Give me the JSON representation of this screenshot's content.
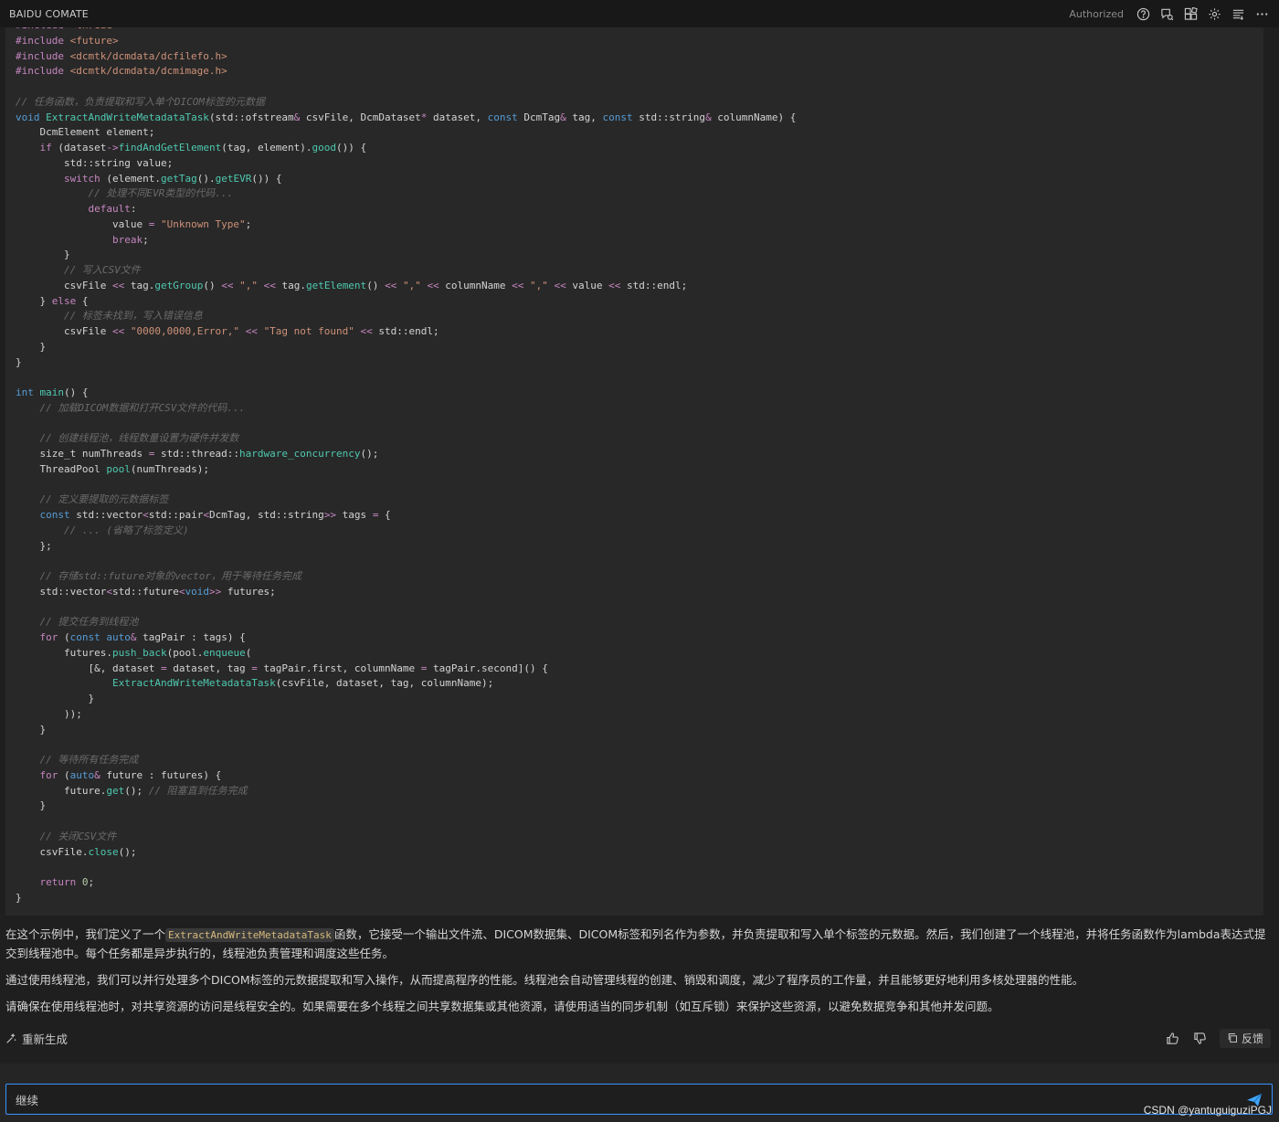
{
  "app": {
    "title": "BAIDU COMATE",
    "status": "Authorized"
  },
  "toolbar_icons": [
    "help-icon",
    "chat-history-icon",
    "plugins-icon",
    "settings-icon",
    "menu-list-icon",
    "more-icon"
  ],
  "code_lines": [
    [
      [
        "pp",
        "#include"
      ],
      [
        "op",
        " "
      ],
      [
        "inc",
        "<thread>"
      ]
    ],
    [
      [
        "pp",
        "#include"
      ],
      [
        "op",
        " "
      ],
      [
        "inc",
        "<future>"
      ]
    ],
    [
      [
        "pp",
        "#include"
      ],
      [
        "op",
        " "
      ],
      [
        "inc",
        "<dcmtk/dcmdata/dcfilefo.h>"
      ]
    ],
    [
      [
        "pp",
        "#include"
      ],
      [
        "op",
        " "
      ],
      [
        "inc",
        "<dcmtk/dcmdata/dcmimage.h>"
      ]
    ],
    [],
    [
      [
        "cm",
        "// 任务函数，负责提取和写入单个DICOM标签的元数据"
      ]
    ],
    [
      [
        "ty",
        "void"
      ],
      [
        "op",
        " "
      ],
      [
        "fn",
        "ExtractAndWriteMetadataTask"
      ],
      [
        "op",
        "(std::ofstream"
      ],
      [
        "kw",
        "&"
      ],
      [
        "op",
        " csvFile, DcmDataset"
      ],
      [
        "kw",
        "*"
      ],
      [
        "op",
        " dataset, "
      ],
      [
        "ty",
        "const"
      ],
      [
        "op",
        " DcmTag"
      ],
      [
        "kw",
        "&"
      ],
      [
        "op",
        " tag, "
      ],
      [
        "ty",
        "const"
      ],
      [
        "op",
        " std::string"
      ],
      [
        "kw",
        "&"
      ],
      [
        "op",
        " columnName) {"
      ]
    ],
    [
      [
        "op",
        "    DcmElement element;"
      ]
    ],
    [
      [
        "op",
        "    "
      ],
      [
        "kw",
        "if"
      ],
      [
        "op",
        " (dataset"
      ],
      [
        "kw",
        "->"
      ],
      [
        "fn",
        "findAndGetElement"
      ],
      [
        "op",
        "(tag, element)."
      ],
      [
        "fn",
        "good"
      ],
      [
        "op",
        "()) {"
      ]
    ],
    [
      [
        "op",
        "        std::string value;"
      ]
    ],
    [
      [
        "op",
        "        "
      ],
      [
        "kw",
        "switch"
      ],
      [
        "op",
        " (element."
      ],
      [
        "fn",
        "getTag"
      ],
      [
        "op",
        "()."
      ],
      [
        "fn",
        "getEVR"
      ],
      [
        "op",
        "()) {"
      ]
    ],
    [
      [
        "op",
        "            "
      ],
      [
        "cm",
        "// 处理不同EVR类型的代码..."
      ]
    ],
    [
      [
        "op",
        "            "
      ],
      [
        "kw",
        "default"
      ],
      [
        "op",
        ":"
      ]
    ],
    [
      [
        "op",
        "                value "
      ],
      [
        "kw",
        "="
      ],
      [
        "op",
        " "
      ],
      [
        "str",
        "\"Unknown Type\""
      ],
      [
        "op",
        ";"
      ]
    ],
    [
      [
        "op",
        "                "
      ],
      [
        "kw",
        "break"
      ],
      [
        "op",
        ";"
      ]
    ],
    [
      [
        "op",
        "        }"
      ]
    ],
    [
      [
        "op",
        "        "
      ],
      [
        "cm",
        "// 写入CSV文件"
      ]
    ],
    [
      [
        "op",
        "        csvFile "
      ],
      [
        "kw",
        "<<"
      ],
      [
        "op",
        " tag."
      ],
      [
        "fn",
        "getGroup"
      ],
      [
        "op",
        "() "
      ],
      [
        "kw",
        "<<"
      ],
      [
        "op",
        " "
      ],
      [
        "str",
        "\",\""
      ],
      [
        "op",
        " "
      ],
      [
        "kw",
        "<<"
      ],
      [
        "op",
        " tag."
      ],
      [
        "fn",
        "getElement"
      ],
      [
        "op",
        "() "
      ],
      [
        "kw",
        "<<"
      ],
      [
        "op",
        " "
      ],
      [
        "str",
        "\",\""
      ],
      [
        "op",
        " "
      ],
      [
        "kw",
        "<<"
      ],
      [
        "op",
        " columnName "
      ],
      [
        "kw",
        "<<"
      ],
      [
        "op",
        " "
      ],
      [
        "str",
        "\",\""
      ],
      [
        "op",
        " "
      ],
      [
        "kw",
        "<<"
      ],
      [
        "op",
        " value "
      ],
      [
        "kw",
        "<<"
      ],
      [
        "op",
        " std::endl;"
      ]
    ],
    [
      [
        "op",
        "    } "
      ],
      [
        "kw",
        "else"
      ],
      [
        "op",
        " {"
      ]
    ],
    [
      [
        "op",
        "        "
      ],
      [
        "cm",
        "// 标签未找到，写入错误信息"
      ]
    ],
    [
      [
        "op",
        "        csvFile "
      ],
      [
        "kw",
        "<<"
      ],
      [
        "op",
        " "
      ],
      [
        "str",
        "\"0000,0000,Error,\""
      ],
      [
        "op",
        " "
      ],
      [
        "kw",
        "<<"
      ],
      [
        "op",
        " "
      ],
      [
        "str",
        "\"Tag not found\""
      ],
      [
        "op",
        " "
      ],
      [
        "kw",
        "<<"
      ],
      [
        "op",
        " std::endl;"
      ]
    ],
    [
      [
        "op",
        "    }"
      ]
    ],
    [
      [
        "op",
        "}"
      ]
    ],
    [],
    [
      [
        "ty",
        "int"
      ],
      [
        "op",
        " "
      ],
      [
        "fn",
        "main"
      ],
      [
        "op",
        "() {"
      ]
    ],
    [
      [
        "op",
        "    "
      ],
      [
        "cm",
        "// 加载DICOM数据和打开CSV文件的代码..."
      ]
    ],
    [],
    [
      [
        "op",
        "    "
      ],
      [
        "cm",
        "// 创建线程池，线程数量设置为硬件并发数"
      ]
    ],
    [
      [
        "op",
        "    size_t numThreads "
      ],
      [
        "kw",
        "="
      ],
      [
        "op",
        " std::thread::"
      ],
      [
        "fn",
        "hardware_concurrency"
      ],
      [
        "op",
        "();"
      ]
    ],
    [
      [
        "op",
        "    ThreadPool "
      ],
      [
        "fn",
        "pool"
      ],
      [
        "op",
        "(numThreads);"
      ]
    ],
    [],
    [
      [
        "op",
        "    "
      ],
      [
        "cm",
        "// 定义要提取的元数据标签"
      ]
    ],
    [
      [
        "op",
        "    "
      ],
      [
        "ty",
        "const"
      ],
      [
        "op",
        " std::vector"
      ],
      [
        "kw",
        "<"
      ],
      [
        "op",
        "std::pair"
      ],
      [
        "kw",
        "<"
      ],
      [
        "op",
        "DcmTag, std::string"
      ],
      [
        "kw",
        ">>"
      ],
      [
        "op",
        " tags "
      ],
      [
        "kw",
        "="
      ],
      [
        "op",
        " {"
      ]
    ],
    [
      [
        "op",
        "        "
      ],
      [
        "cm",
        "// ... (省略了标签定义)"
      ]
    ],
    [
      [
        "op",
        "    };"
      ]
    ],
    [],
    [
      [
        "op",
        "    "
      ],
      [
        "cm",
        "// 存储std::future对象的vector，用于等待任务完成"
      ]
    ],
    [
      [
        "op",
        "    std::vector"
      ],
      [
        "kw",
        "<"
      ],
      [
        "op",
        "std::future"
      ],
      [
        "kw",
        "<"
      ],
      [
        "ty",
        "void"
      ],
      [
        "kw",
        ">>"
      ],
      [
        "op",
        " futures;"
      ]
    ],
    [],
    [
      [
        "op",
        "    "
      ],
      [
        "cm",
        "// 提交任务到线程池"
      ]
    ],
    [
      [
        "op",
        "    "
      ],
      [
        "kw",
        "for"
      ],
      [
        "op",
        " ("
      ],
      [
        "ty",
        "const"
      ],
      [
        "op",
        " "
      ],
      [
        "ty",
        "auto"
      ],
      [
        "kw",
        "&"
      ],
      [
        "op",
        " tagPair : tags) {"
      ]
    ],
    [
      [
        "op",
        "        futures."
      ],
      [
        "fn",
        "push_back"
      ],
      [
        "op",
        "(pool."
      ],
      [
        "fn",
        "enqueue"
      ],
      [
        "op",
        "("
      ]
    ],
    [
      [
        "op",
        "            [&, dataset "
      ],
      [
        "kw",
        "="
      ],
      [
        "op",
        " dataset, tag "
      ],
      [
        "kw",
        "="
      ],
      [
        "op",
        " tagPair.first, columnName "
      ],
      [
        "kw",
        "="
      ],
      [
        "op",
        " tagPair.second]() {"
      ]
    ],
    [
      [
        "op",
        "                "
      ],
      [
        "fn",
        "ExtractAndWriteMetadataTask"
      ],
      [
        "op",
        "(csvFile, dataset, tag, columnName);"
      ]
    ],
    [
      [
        "op",
        "            }"
      ]
    ],
    [
      [
        "op",
        "        ));"
      ]
    ],
    [
      [
        "op",
        "    }"
      ]
    ],
    [],
    [
      [
        "op",
        "    "
      ],
      [
        "cm",
        "// 等待所有任务完成"
      ]
    ],
    [
      [
        "op",
        "    "
      ],
      [
        "kw",
        "for"
      ],
      [
        "op",
        " ("
      ],
      [
        "ty",
        "auto"
      ],
      [
        "kw",
        "&"
      ],
      [
        "op",
        " future : futures) {"
      ]
    ],
    [
      [
        "op",
        "        future."
      ],
      [
        "fn",
        "get"
      ],
      [
        "op",
        "(); "
      ],
      [
        "cm",
        "// 阻塞直到任务完成"
      ]
    ],
    [
      [
        "op",
        "    }"
      ]
    ],
    [],
    [
      [
        "op",
        "    "
      ],
      [
        "cm",
        "// 关闭CSV文件"
      ]
    ],
    [
      [
        "op",
        "    csvFile."
      ],
      [
        "fn",
        "close"
      ],
      [
        "op",
        "();"
      ]
    ],
    [],
    [
      [
        "op",
        "    "
      ],
      [
        "kw",
        "return"
      ],
      [
        "op",
        " "
      ],
      [
        "num",
        "0"
      ],
      [
        "op",
        ";"
      ]
    ],
    [
      [
        "op",
        "}"
      ]
    ]
  ],
  "answer": {
    "p1_before": "在这个示例中，我们定义了一个",
    "p1_code": "ExtractAndWriteMetadataTask",
    "p1_after": "函数，它接受一个输出文件流、DICOM数据集、DICOM标签和列名作为参数，并负责提取和写入单个标签的元数据。然后，我们创建了一个线程池，并将任务函数作为lambda表达式提交到线程池中。每个任务都是异步执行的，线程池负责管理和调度这些任务。",
    "p2": "通过使用线程池，我们可以并行处理多个DICOM标签的元数据提取和写入操作，从而提高程序的性能。线程池会自动管理线程的创建、销毁和调度，减少了程序员的工作量，并且能够更好地利用多核处理器的性能。",
    "p3": "请确保在使用线程池时，对共享资源的访问是线程安全的。如果需要在多个线程之间共享数据集或其他资源，请使用适当的同步机制（如互斥锁）来保护这些资源，以避免数据竞争和其他并发问题。"
  },
  "actions": {
    "regenerate": "重新生成",
    "feedback": "反馈"
  },
  "input": {
    "value": "继续"
  },
  "watermark": "CSDN @yantuguiguziPGJ",
  "colors": {
    "background": "#1f1f1f",
    "code_background": "#282828",
    "accent": "#3794ff",
    "send": "#3ea6ff"
  }
}
